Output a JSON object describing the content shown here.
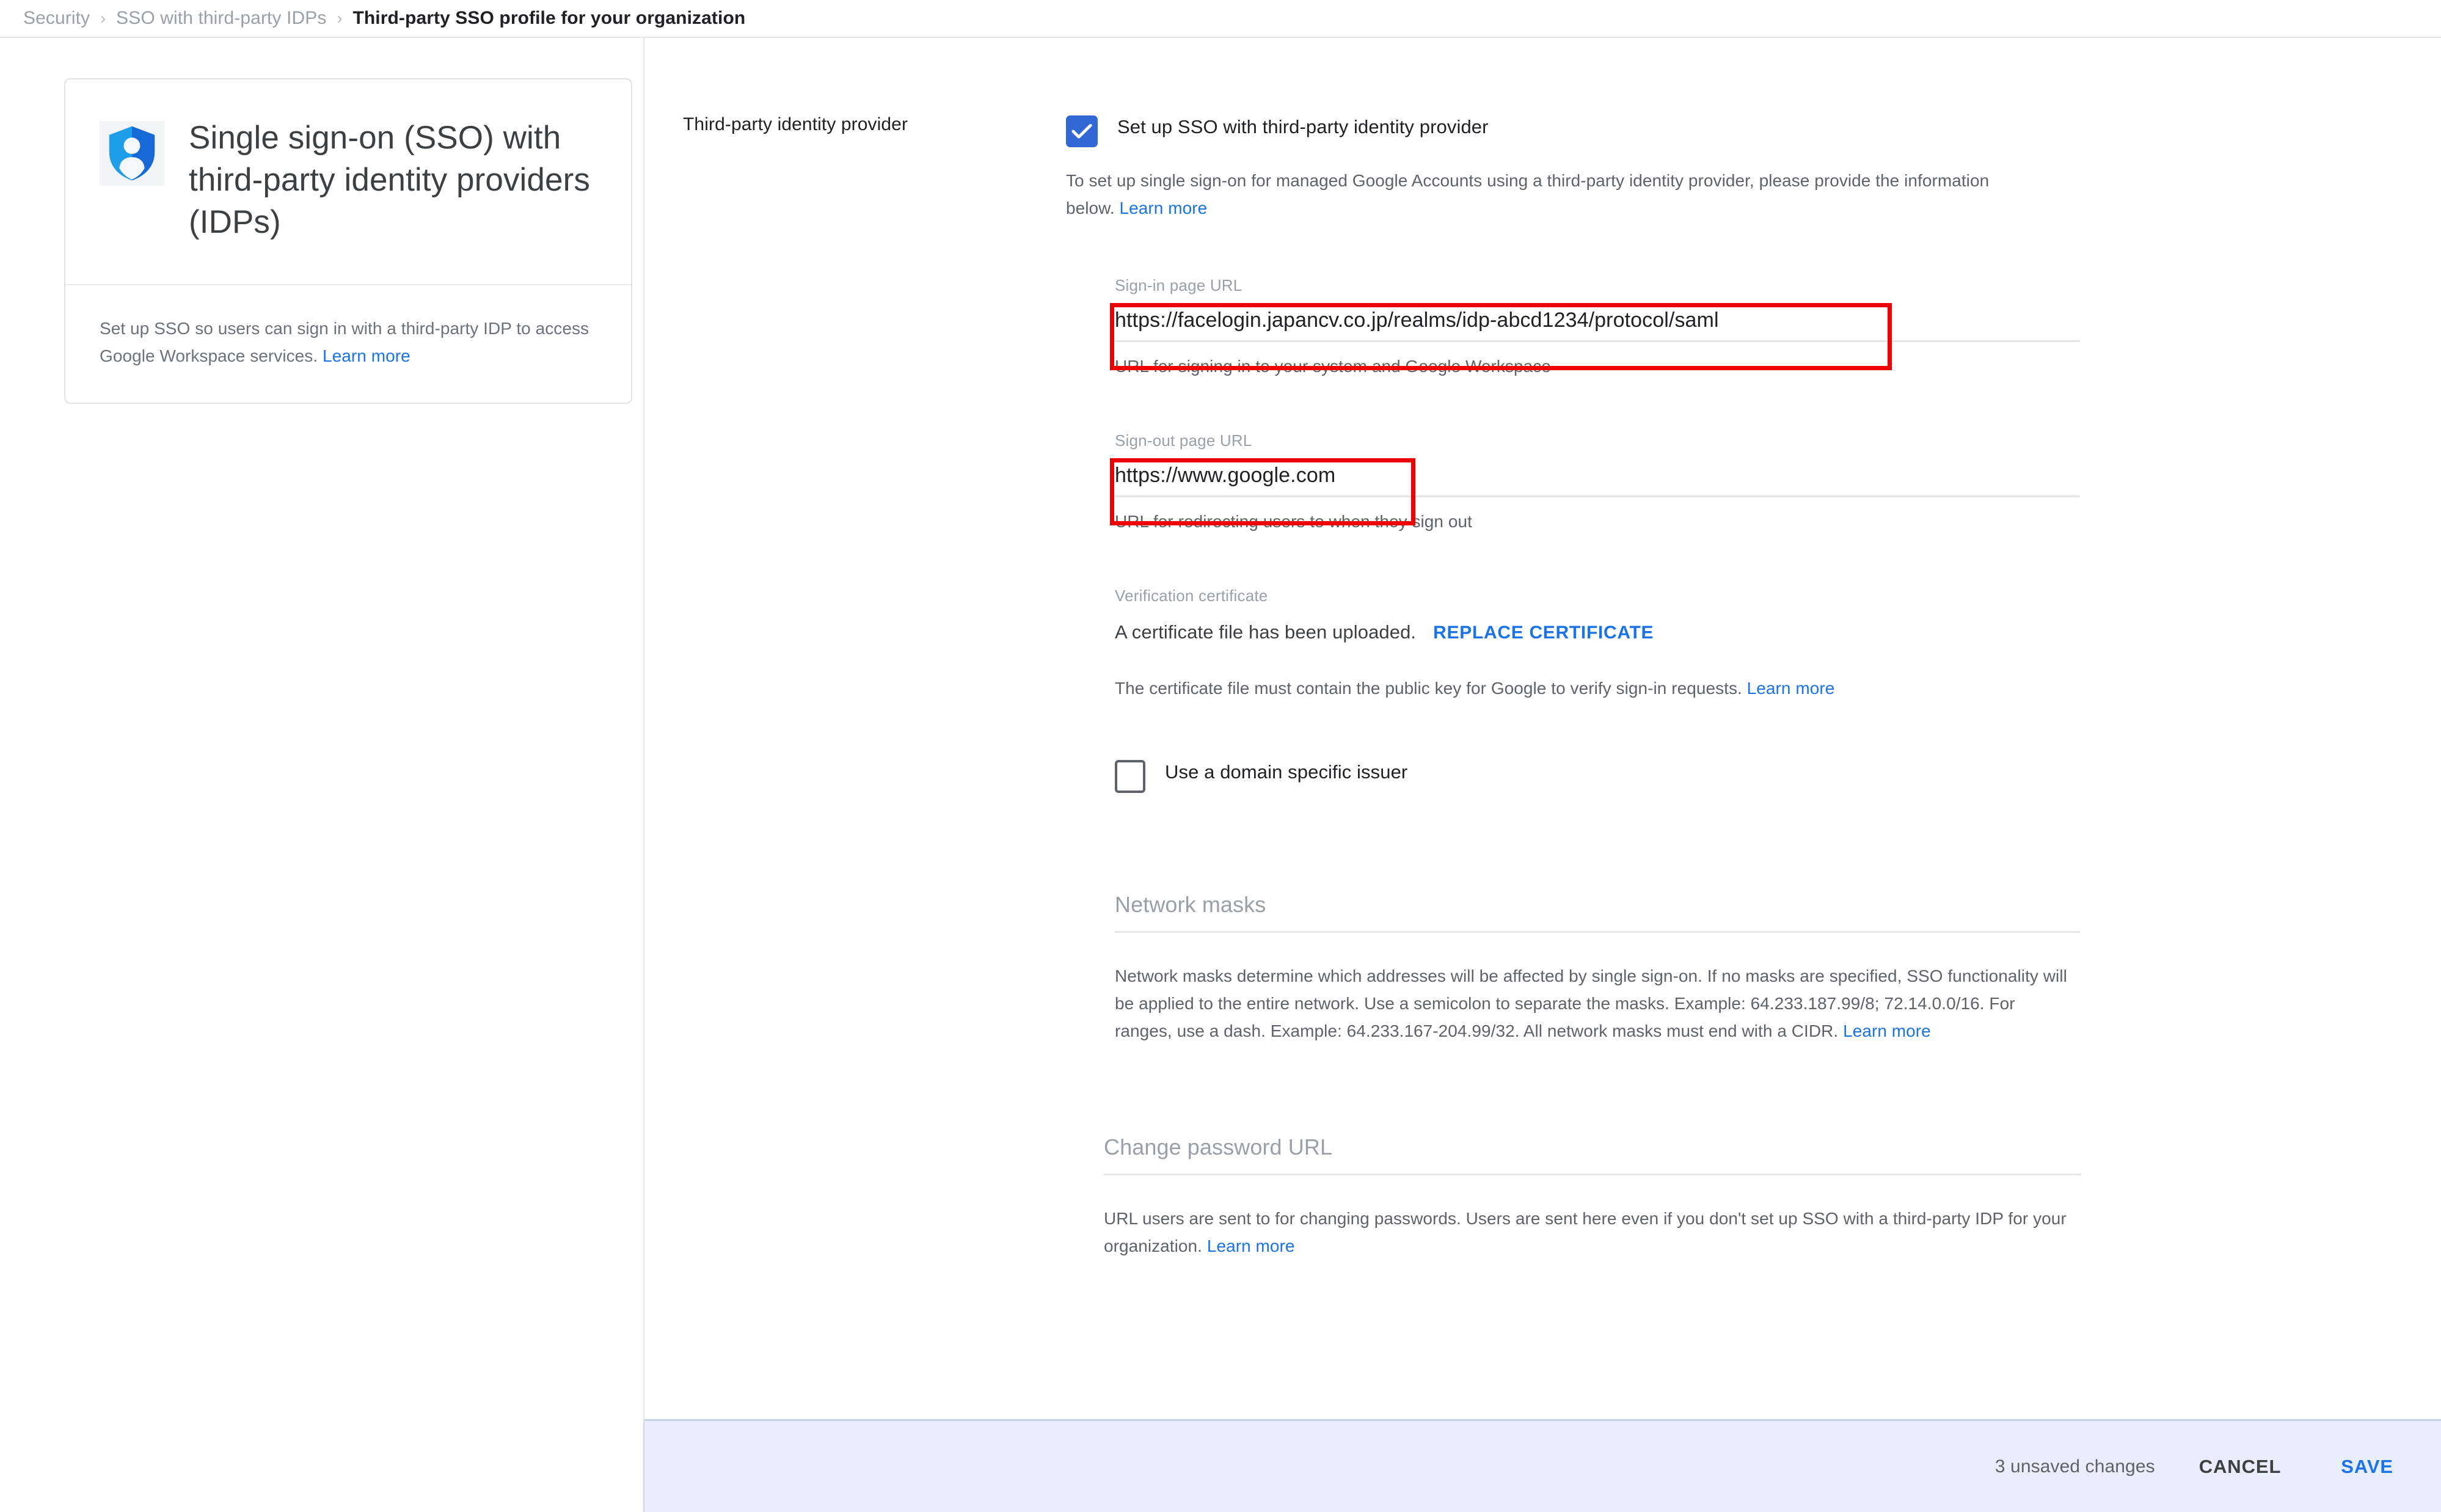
{
  "breadcrumb": {
    "items": [
      {
        "label": "Security",
        "current": false
      },
      {
        "label": "SSO with third-party IDPs",
        "current": false
      },
      {
        "label": "Third-party SSO profile for your organization",
        "current": true
      }
    ],
    "separator": "›"
  },
  "info_card": {
    "icon": "shield-person-icon",
    "title": "Single sign-on (SSO) with third-party identity providers (IDPs)",
    "description": "Set up SSO so users can sign in with a third-party IDP to access Google Workspace services.",
    "learn_more": "Learn more"
  },
  "main": {
    "section_label": "Third-party identity provider",
    "setup_checkbox": {
      "label": "Set up SSO with third-party identity provider",
      "checked": true
    },
    "intro": {
      "text": "To set up single sign-on for managed Google Accounts using a third-party identity provider, please provide the information below.",
      "learn_more": "Learn more"
    },
    "fields": {
      "signin": {
        "label": "Sign-in page URL",
        "value": "https://facelogin.japancv.co.jp/realms/idp-abcd1234/protocol/saml",
        "help": "URL for signing in to your system and Google Workspace",
        "highlighted": true
      },
      "signout": {
        "label": "Sign-out page URL",
        "value": "https://www.google.com",
        "help": "URL for redirecting users to when they sign out",
        "highlighted": true
      },
      "certificate": {
        "label": "Verification certificate",
        "status": "A certificate file has been uploaded.",
        "action": "REPLACE CERTIFICATE",
        "help": "The certificate file must contain the public key for Google to verify sign-in requests.",
        "learn_more": "Learn more"
      },
      "domain_issuer_checkbox": {
        "label": "Use a domain specific issuer",
        "checked": false
      },
      "network_masks": {
        "title": "Network masks",
        "help": "Network masks determine which addresses will be affected by single sign-on. If no masks are specified, SSO functionality will be applied to the entire network. Use a semicolon to separate the masks. Example: 64.233.187.99/8; 72.14.0.0/16. For ranges, use a dash. Example: 64.233.167-204.99/32. All network masks must end with a CIDR.",
        "learn_more": "Learn more"
      },
      "change_password": {
        "title": "Change password URL",
        "help": "URL users are sent to for changing passwords. Users are sent here even if you don't set up SSO with a third-party IDP for your organization.",
        "learn_more": "Learn more"
      }
    }
  },
  "action_bar": {
    "unsaved_changes": "3 unsaved changes",
    "cancel_label": "CANCEL",
    "save_label": "SAVE"
  },
  "colors": {
    "accent_blue": "#1a73e8",
    "checkbox_blue": "#3367d6",
    "annotation_red": "#ee0000",
    "action_bar_bg": "#e8eefb",
    "shield_light": "#1e9de8",
    "shield_dark": "#1769d8"
  }
}
